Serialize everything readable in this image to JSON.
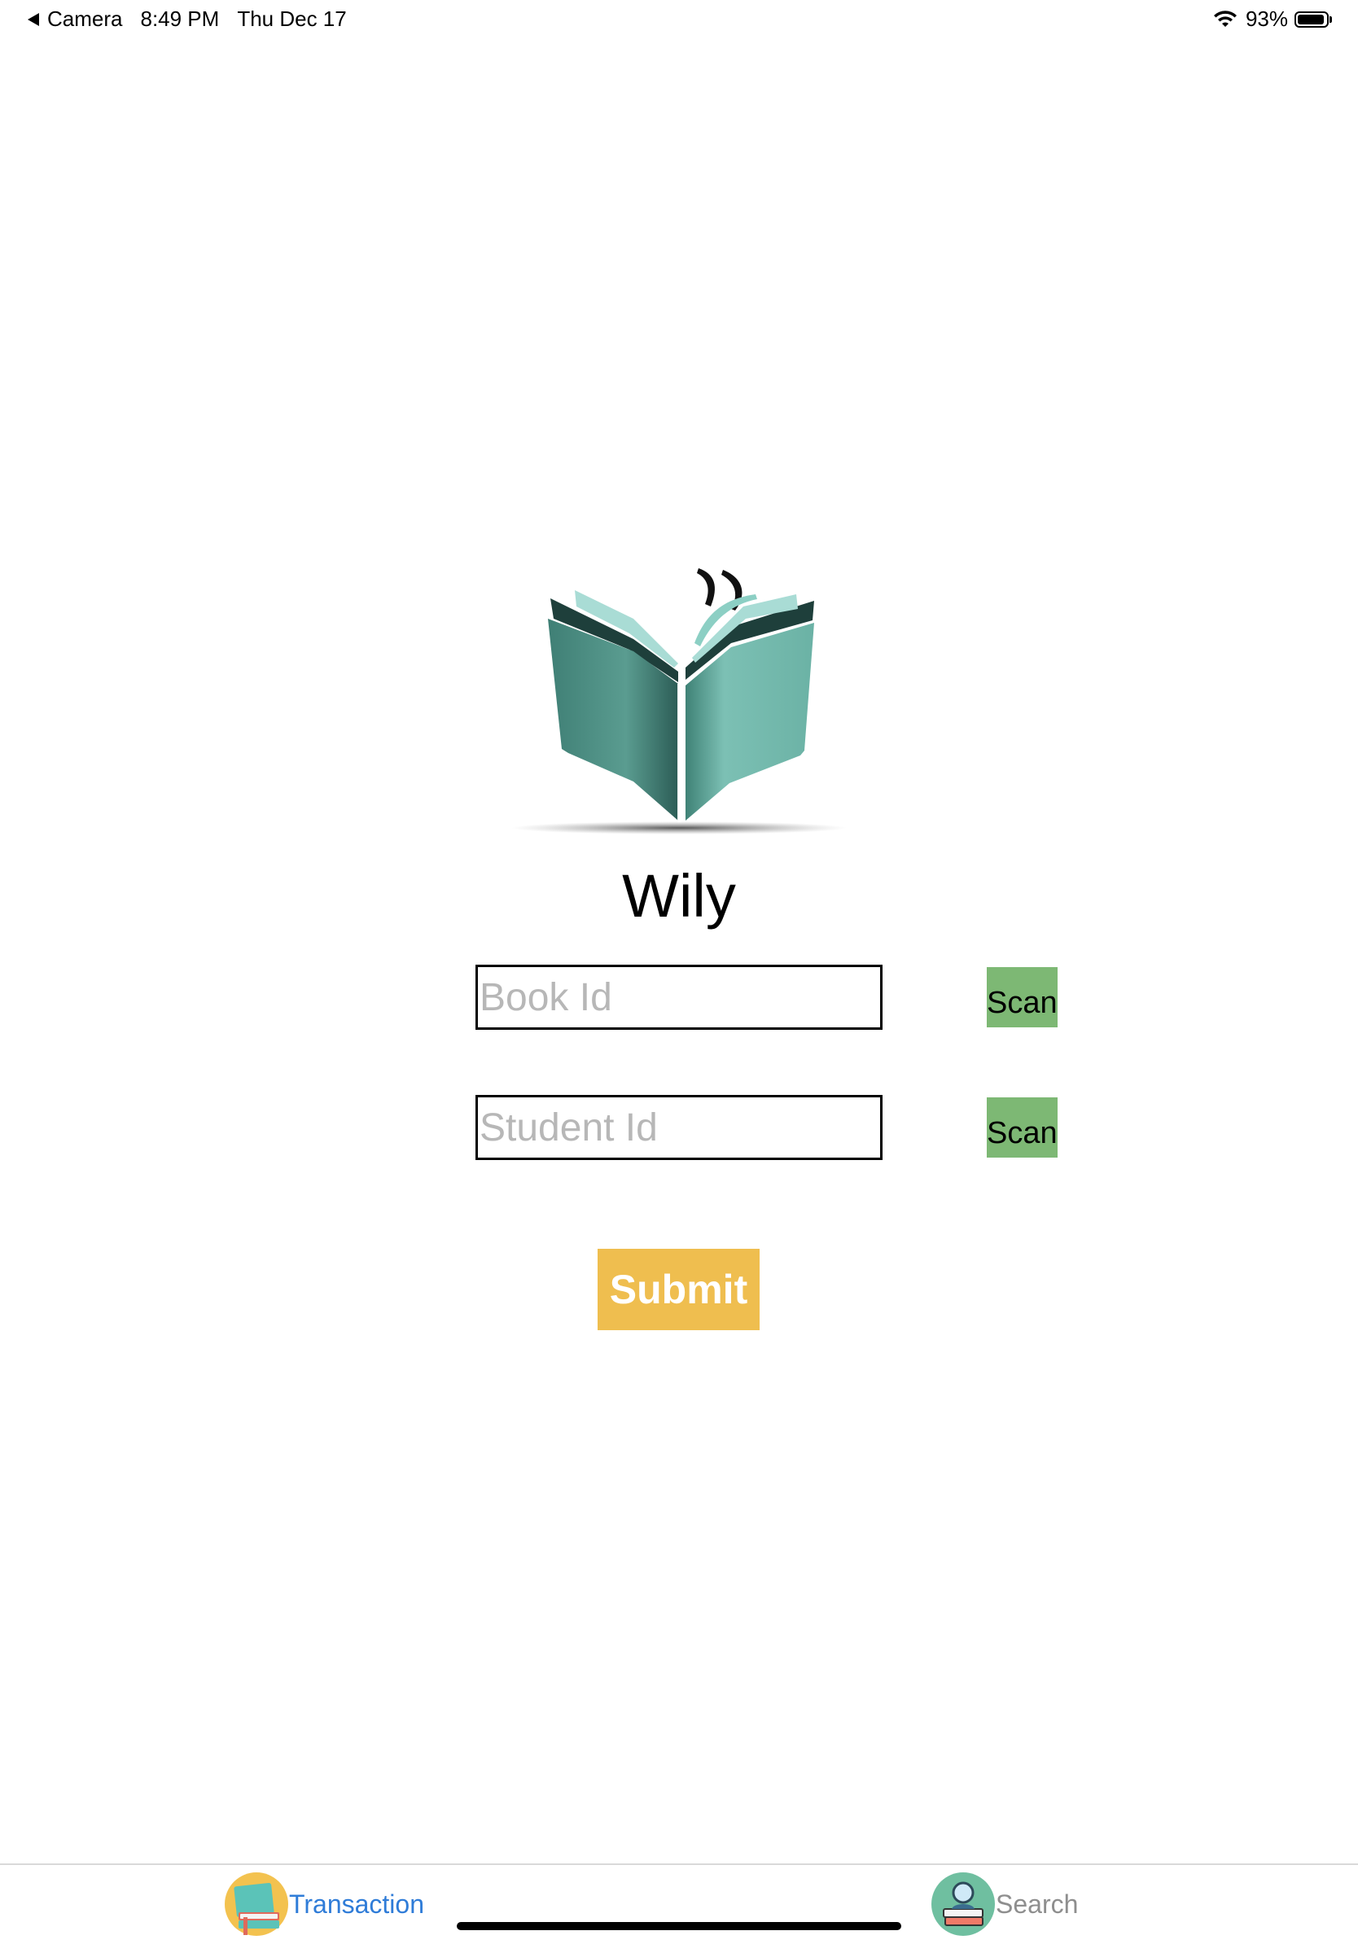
{
  "status_bar": {
    "back_app": "Camera",
    "time": "8:49 PM",
    "date": "Thu Dec 17",
    "battery_text": "93%",
    "battery_level": 0.93
  },
  "app": {
    "title": "Wily",
    "logo_icon": "open-book-logo"
  },
  "form": {
    "book_id": {
      "placeholder": "Book Id",
      "value": "",
      "scan_label": "Scan"
    },
    "student_id": {
      "placeholder": "Student Id",
      "value": "",
      "scan_label": "Scan"
    },
    "submit_label": "Submit"
  },
  "tab_bar": {
    "tabs": [
      {
        "label": "Transaction",
        "icon": "book-stack-icon",
        "active": true
      },
      {
        "label": "Search",
        "icon": "search-books-icon",
        "active": false
      }
    ]
  },
  "colors": {
    "scan_button": "#7db874",
    "submit_button": "#efbe4f",
    "active_tab": "#2f7cd8",
    "inactive_tab": "#8e8e8e",
    "logo_teal": "#5fa89c"
  }
}
